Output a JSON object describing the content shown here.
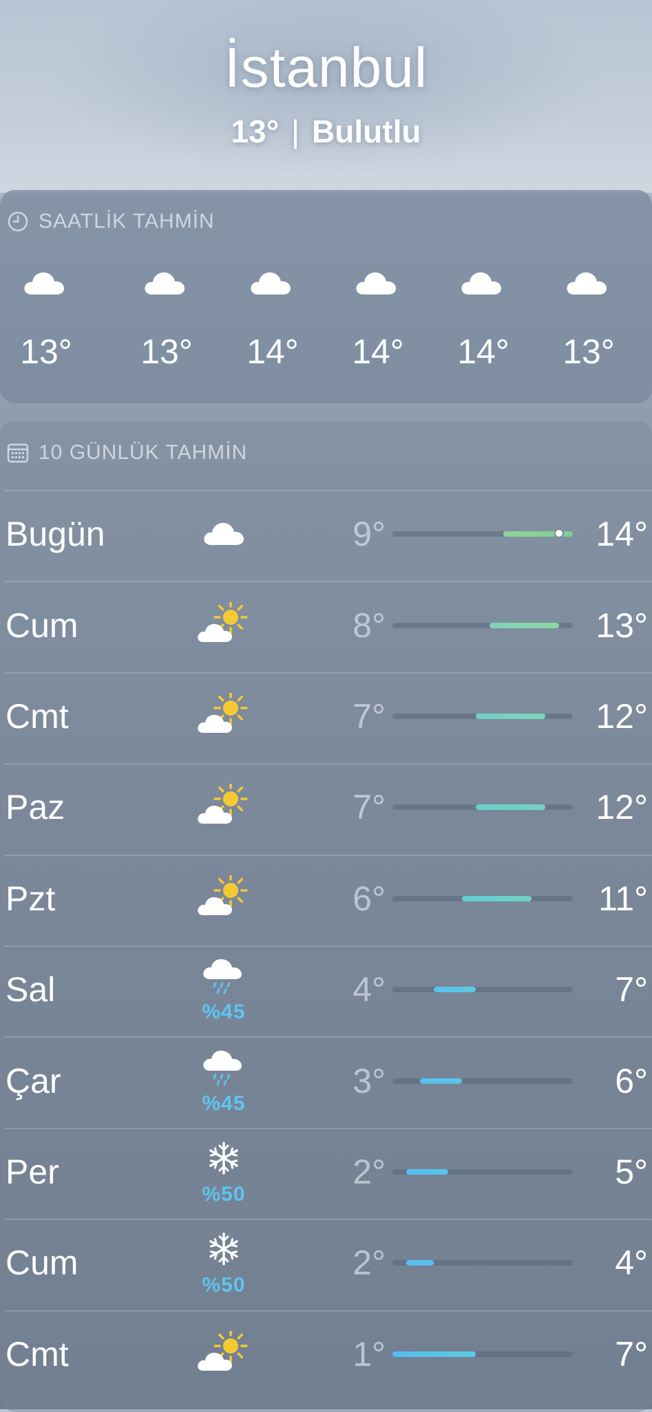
{
  "location": {
    "city": "İstanbul",
    "temp": "13°",
    "separator": "|",
    "condition": "Bulutlu"
  },
  "hourly": {
    "title": "SAATLİK TAHMİN",
    "icon": "clock-icon",
    "items": [
      {
        "temp": "13°",
        "icon": "cloud-icon"
      },
      {
        "temp": "13°",
        "icon": "cloud-icon"
      },
      {
        "temp": "14°",
        "icon": "cloud-icon"
      },
      {
        "temp": "14°",
        "icon": "cloud-icon"
      },
      {
        "temp": "14°",
        "icon": "cloud-icon"
      },
      {
        "temp": "13°",
        "icon": "cloud-icon"
      }
    ]
  },
  "daily": {
    "title": "10 GÜNLÜK TAHMİN",
    "icon": "calendar-icon",
    "range_min": 1,
    "range_max": 14,
    "days": [
      {
        "name": "Bugün",
        "icon": "cloud-icon",
        "precip": "",
        "low": "9°",
        "high": "14°",
        "lo": 9,
        "hi": 14,
        "color_start": "#8fd49a",
        "color_end": "#7ccf93",
        "current": 13
      },
      {
        "name": "Cum",
        "icon": "partly-sunny-icon",
        "precip": "",
        "low": "8°",
        "high": "13°",
        "lo": 8,
        "hi": 13,
        "color_start": "#7dd3b8",
        "color_end": "#8ed7a4"
      },
      {
        "name": "Cmt",
        "icon": "partly-sunny-icon",
        "precip": "",
        "low": "7°",
        "high": "12°",
        "lo": 7,
        "hi": 12,
        "color_start": "#70d2c6",
        "color_end": "#7bd4b6"
      },
      {
        "name": "Paz",
        "icon": "partly-sunny-icon",
        "precip": "",
        "low": "7°",
        "high": "12°",
        "lo": 7,
        "hi": 12,
        "color_start": "#6ad0cc",
        "color_end": "#76d3bd"
      },
      {
        "name": "Pzt",
        "icon": "partly-sunny-icon",
        "precip": "",
        "low": "6°",
        "high": "11°",
        "lo": 6,
        "hi": 11,
        "color_start": "#62cdd6",
        "color_end": "#6fd2c4"
      },
      {
        "name": "Sal",
        "icon": "cloud-rain-icon",
        "precip": "%45",
        "low": "4°",
        "high": "7°",
        "lo": 4,
        "hi": 7,
        "color_start": "#58c2ec",
        "color_end": "#5ccbe0"
      },
      {
        "name": "Çar",
        "icon": "cloud-rain-icon",
        "precip": "%45",
        "low": "3°",
        "high": "6°",
        "lo": 3,
        "hi": 6,
        "color_start": "#56c0ee",
        "color_end": "#5ac6e6"
      },
      {
        "name": "Per",
        "icon": "snowflake-icon",
        "precip": "%50",
        "low": "2°",
        "high": "5°",
        "lo": 2,
        "hi": 5,
        "color_start": "#55bff0",
        "color_end": "#58c3ea"
      },
      {
        "name": "Cum",
        "icon": "snowflake-icon",
        "precip": "%50",
        "low": "2°",
        "high": "4°",
        "lo": 2,
        "hi": 4,
        "color_start": "#55bff0",
        "color_end": "#57c2ec"
      },
      {
        "name": "Cmt",
        "icon": "partly-sunny-icon",
        "precip": "",
        "low": "1°",
        "high": "7°",
        "lo": 1,
        "hi": 7,
        "color_start": "#53bdf2",
        "color_end": "#5ccae0"
      }
    ]
  }
}
